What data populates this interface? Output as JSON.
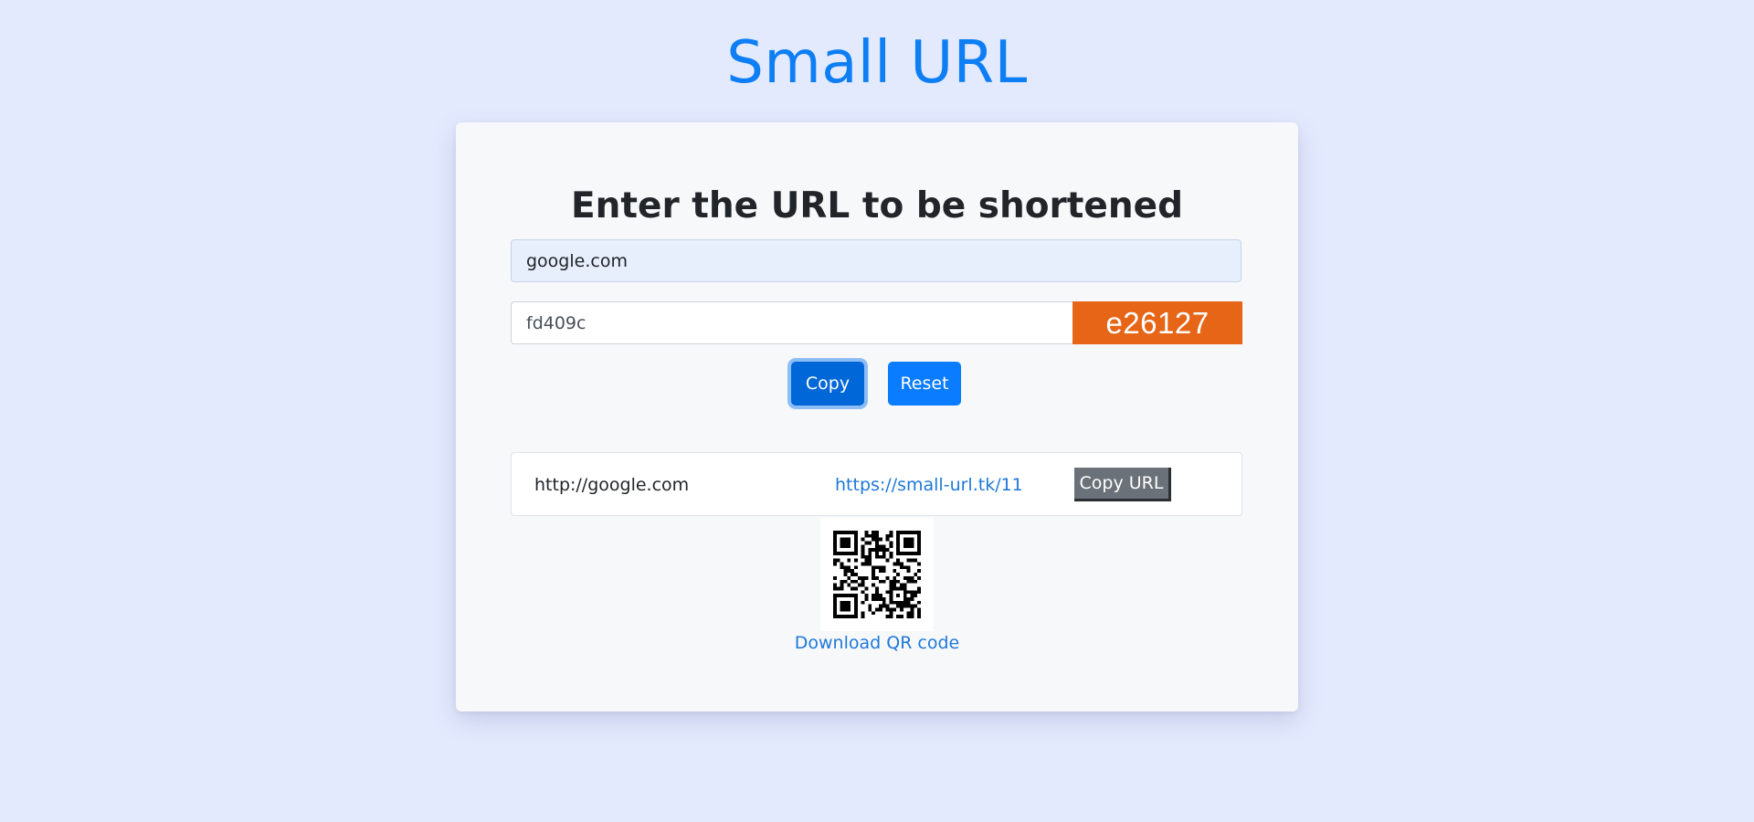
{
  "app": {
    "title": "Small URL"
  },
  "form": {
    "heading": "Enter the URL to be shortened",
    "url_input_value": "google.com",
    "captcha_input_value": "fd409c",
    "captcha_code": "e26127",
    "copy_label": "Copy",
    "reset_label": "Reset"
  },
  "result": {
    "long_url": "http://google.com",
    "short_url": "https://small-url.tk/11",
    "copy_url_label": "Copy URL"
  },
  "qr": {
    "icon": "qr-code-icon",
    "download_label": "Download QR code"
  },
  "colors": {
    "accent": "#0d7ef4",
    "background": "#e4eafe",
    "captcha_bg": "#e66517",
    "copy_url_bg": "#6b7178"
  }
}
